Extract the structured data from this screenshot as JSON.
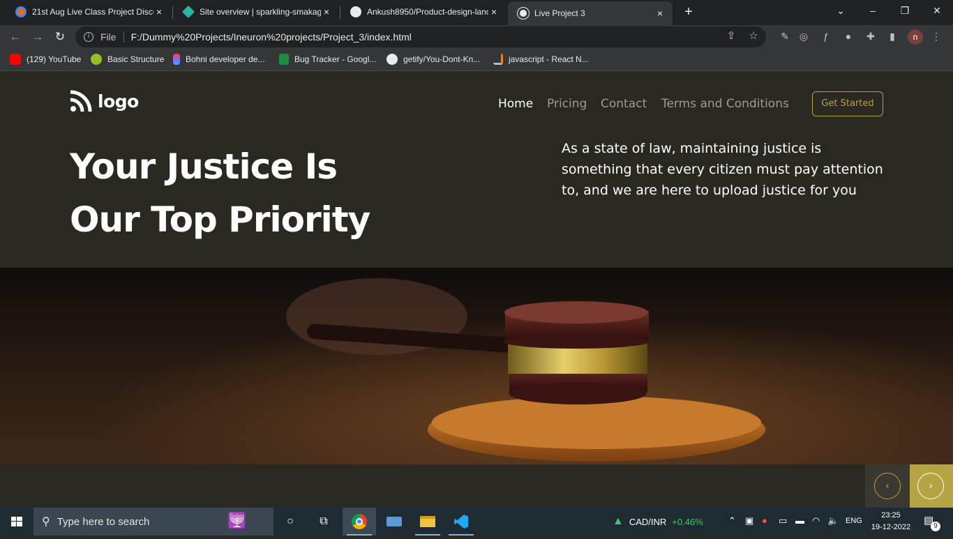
{
  "browser": {
    "tabs": [
      {
        "title": "21st Aug Live Class Project Discu",
        "close": "×",
        "active": false
      },
      {
        "title": "Site overview | sparkling-smakag",
        "close": "×",
        "active": false
      },
      {
        "title": "Ankush8950/Product-design-lanc",
        "close": "×",
        "active": false
      },
      {
        "title": "Live Project 3",
        "close": "×",
        "active": true
      }
    ],
    "new_tab": "+",
    "address": {
      "scheme_label": "File",
      "url": "F:/Dummy%20Projects/Ineuron%20projects/Project_3/index.html"
    },
    "profile_initial": "n",
    "bookmarks": [
      {
        "label": "(129) YouTube",
        "icon": "youtube-icon",
        "color": "#ff0000"
      },
      {
        "label": "Basic Structure",
        "icon": "android-icon",
        "color": "#97c024"
      },
      {
        "label": "Bohni developer de...",
        "icon": "figma-icon",
        "color": "#f24e1e"
      },
      {
        "label": "Bug Tracker - Googl...",
        "icon": "sheets-icon",
        "color": "#1e8e3e"
      },
      {
        "label": "getify/You-Dont-Kn...",
        "icon": "github-icon",
        "color": "#e8eaed"
      },
      {
        "label": "javascript - React N...",
        "icon": "stackoverflow-icon",
        "color": "#f48024"
      }
    ]
  },
  "site": {
    "logo_text": "logo",
    "nav": [
      {
        "label": "Home",
        "active": true
      },
      {
        "label": "Pricing",
        "active": false
      },
      {
        "label": "Contact",
        "active": false
      },
      {
        "label": "Terms and Conditions",
        "active": false
      }
    ],
    "cta_label": "Get Started",
    "hero": {
      "title_line1": "Your Justice Is",
      "title_line2": "Our Top Priority",
      "description": "As a state of law, maintaining justice is something that every citizen must pay attention to, and we are here to upload justice for you"
    },
    "slider": {
      "prev_glyph": "‹",
      "next_glyph": "›"
    },
    "colors": {
      "background": "#2b2822",
      "accent": "#b5a443",
      "nav_muted": "#9e9b94"
    }
  },
  "taskbar": {
    "search_placeholder": "Type here to search",
    "ticker": {
      "symbol": "CAD/INR",
      "change": "+0.46%"
    },
    "language": "ENG",
    "time": "23:25",
    "date": "19-12-2022",
    "notification_count": "9"
  }
}
